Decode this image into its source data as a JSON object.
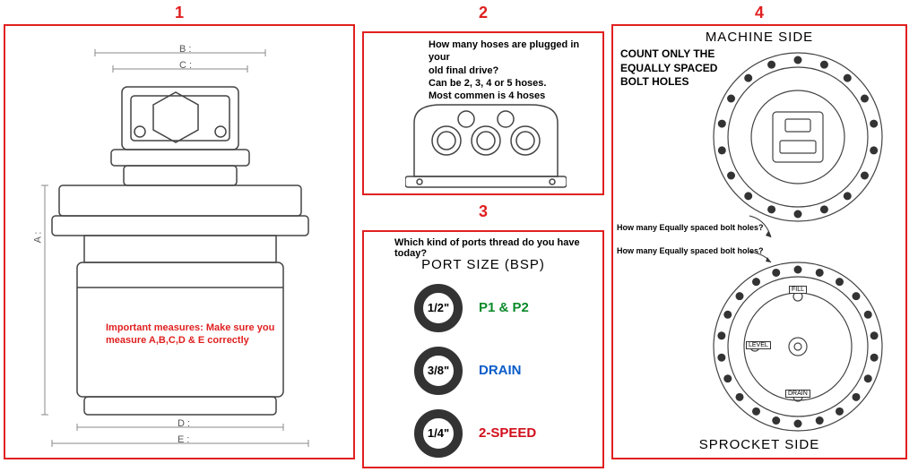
{
  "panels": {
    "1": {
      "number": "1",
      "dims": {
        "A": "A :",
        "B": "B :",
        "C": "C :",
        "D": "D :",
        "E": "E :"
      },
      "important": "Important measures: Make sure you measure A,B,C,D & E correctly"
    },
    "2": {
      "number": "2",
      "question": "How many hoses are plugged in your\nold final drive?\nCan be 2, 3, 4 or 5 hoses.\nMost commen is 4 hoses"
    },
    "3": {
      "number": "3",
      "question": "Which kind of ports thread do you have today?",
      "title": "PORT SIZE (BSP)",
      "ports": [
        {
          "size": "1/2\"",
          "label": "P1 & P2",
          "cls": "green"
        },
        {
          "size": "3/8\"",
          "label": "DRAIN",
          "cls": "blue"
        },
        {
          "size": "1/4\"",
          "label": "2-SPEED",
          "cls": "red"
        }
      ]
    },
    "4": {
      "number": "4",
      "top": "MACHINE SIDE",
      "bottom": "SPROCKET SIDE",
      "count": "COUNT ONLY THE EQUALLY SPACED BOLT HOLES",
      "how1": "How many Equally spaced bolt holes?",
      "how2": "How many Equally spaced bolt holes?",
      "marks": {
        "fill": "FILL",
        "level": "LEVEL",
        "drain": "DRAIN"
      }
    }
  }
}
